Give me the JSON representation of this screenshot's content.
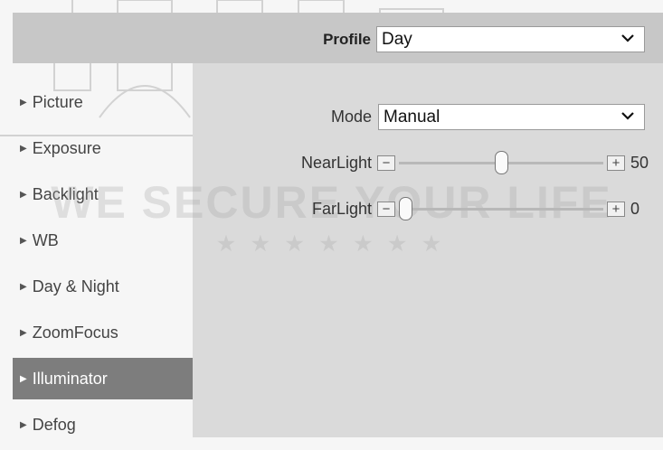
{
  "profile": {
    "label": "Profile",
    "value": "Day"
  },
  "sidebar": {
    "items": [
      {
        "label": "Picture",
        "active": false
      },
      {
        "label": "Exposure",
        "active": false
      },
      {
        "label": "Backlight",
        "active": false
      },
      {
        "label": "WB",
        "active": false
      },
      {
        "label": "Day & Night",
        "active": false
      },
      {
        "label": "ZoomFocus",
        "active": false
      },
      {
        "label": "Illuminator",
        "active": true
      },
      {
        "label": "Defog",
        "active": false
      }
    ]
  },
  "illuminator": {
    "mode": {
      "label": "Mode",
      "value": "Manual"
    },
    "near_light": {
      "label": "NearLight",
      "value": "50",
      "level": 0.5,
      "minus": "−",
      "plus": "+"
    },
    "far_light": {
      "label": "FarLight",
      "value": "0",
      "level": 0.0,
      "minus": "−",
      "plus": "+"
    }
  },
  "watermark": {
    "text": "WE SECURE YOUR LIFE",
    "stars": "★ ★ ★ ★ ★ ★ ★"
  },
  "colors": {
    "active_item": "#7d7d7d",
    "panel": "#dadada",
    "header": "#c7c7c7"
  },
  "icons": {
    "dropdown": "chevron-down-icon",
    "sidebar_bullet": "triangle-right-icon"
  }
}
